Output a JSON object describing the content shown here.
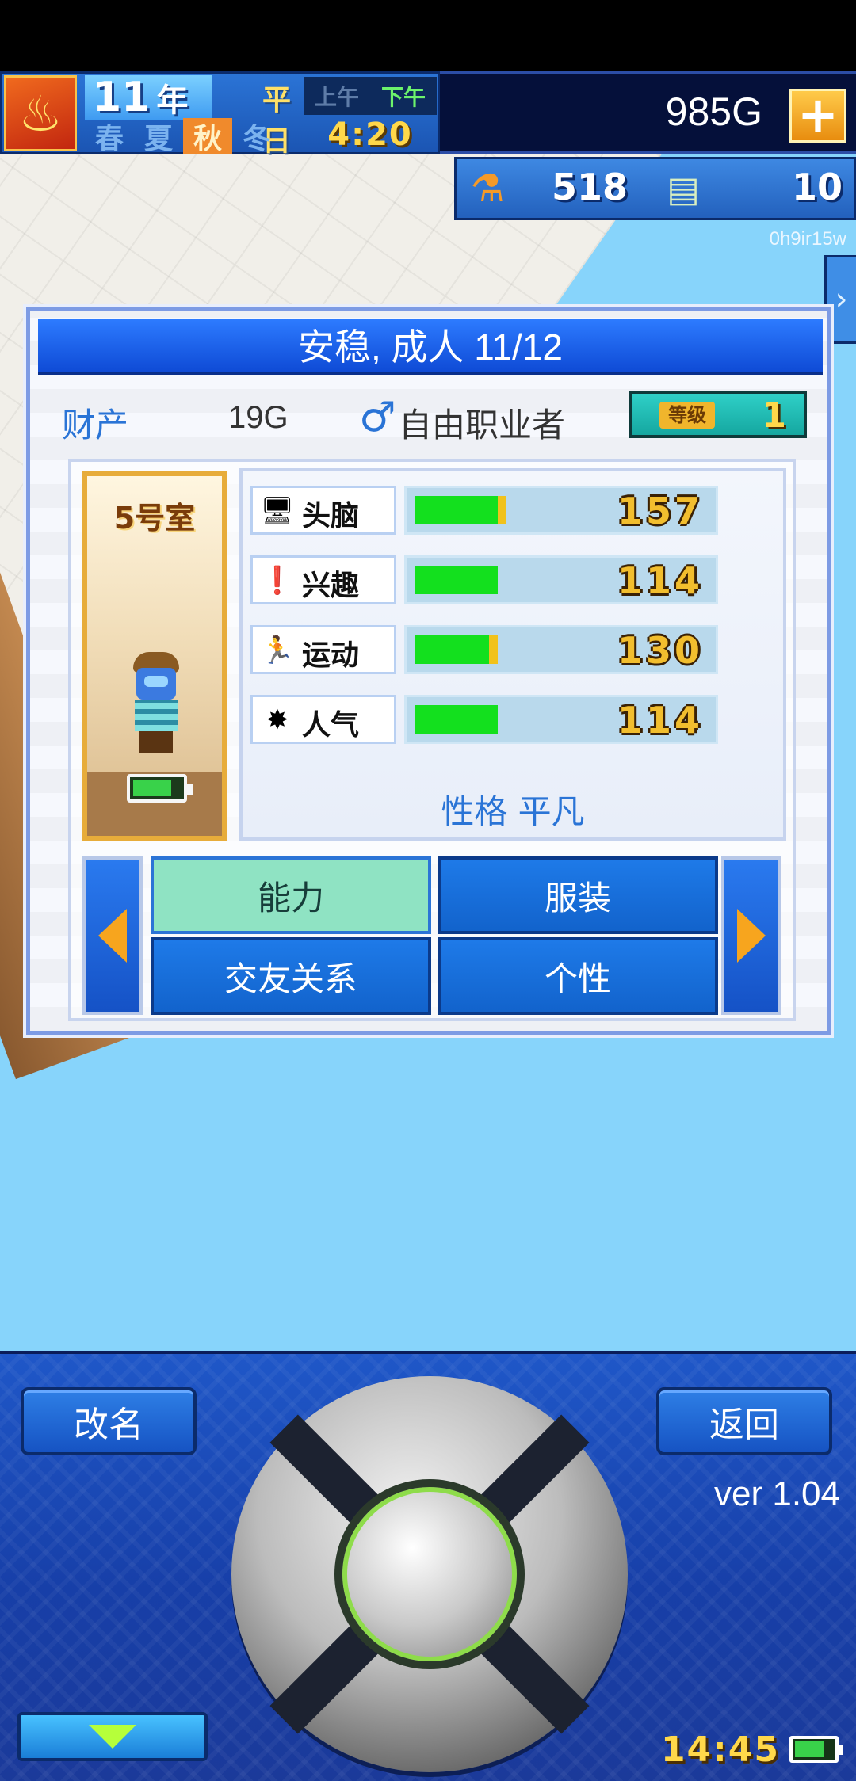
{
  "hud": {
    "year": "11",
    "year_unit": "年",
    "weekday": "平日",
    "am": "上午",
    "pm": "下午",
    "seasons": [
      "春",
      "夏",
      "秋",
      "冬"
    ],
    "active_season": "秋",
    "time": "4:20",
    "money": "985G",
    "add_label": "+",
    "research_points": "518",
    "tickets": "10",
    "player_id": "0h9ir15w",
    "side_tab_icon": "chevron-right-icon"
  },
  "panel": {
    "title": "安稳, 成人 11/12",
    "assets_label": "财产",
    "assets_value": "19G",
    "gender_icon": "♂",
    "job": "自由职业者",
    "level_label": "等级",
    "level_value": "1",
    "room": "5号室",
    "stats": [
      {
        "icon": "brain-icon",
        "glyph": "🖥",
        "label": "头脑",
        "value": "157",
        "fill": 0.62,
        "extra": 0.06
      },
      {
        "icon": "hobby-icon",
        "glyph": "❗",
        "label": "兴趣",
        "value": "114",
        "fill": 0.62,
        "extra": 0
      },
      {
        "icon": "sport-icon",
        "glyph": "🏃",
        "label": "运动",
        "value": "130",
        "fill": 0.55,
        "extra": 0.07
      },
      {
        "icon": "popularity-icon",
        "glyph": "✸",
        "label": "人气",
        "value": "114",
        "fill": 0.62,
        "extra": 0
      }
    ],
    "personality": "性格 平凡",
    "tabs": [
      {
        "label": "能力",
        "active": true
      },
      {
        "label": "服装",
        "active": false
      },
      {
        "label": "交友关系",
        "active": false
      },
      {
        "label": "个性",
        "active": false
      }
    ]
  },
  "controller": {
    "rename": "改名",
    "back": "返回",
    "version": "ver 1.04",
    "clock": "14:45"
  },
  "colors": {
    "accent": "#2a74d6",
    "bar_fill": "#13e01e",
    "value_gold": "#f2be2e",
    "panel_title": "#1f63e8"
  }
}
